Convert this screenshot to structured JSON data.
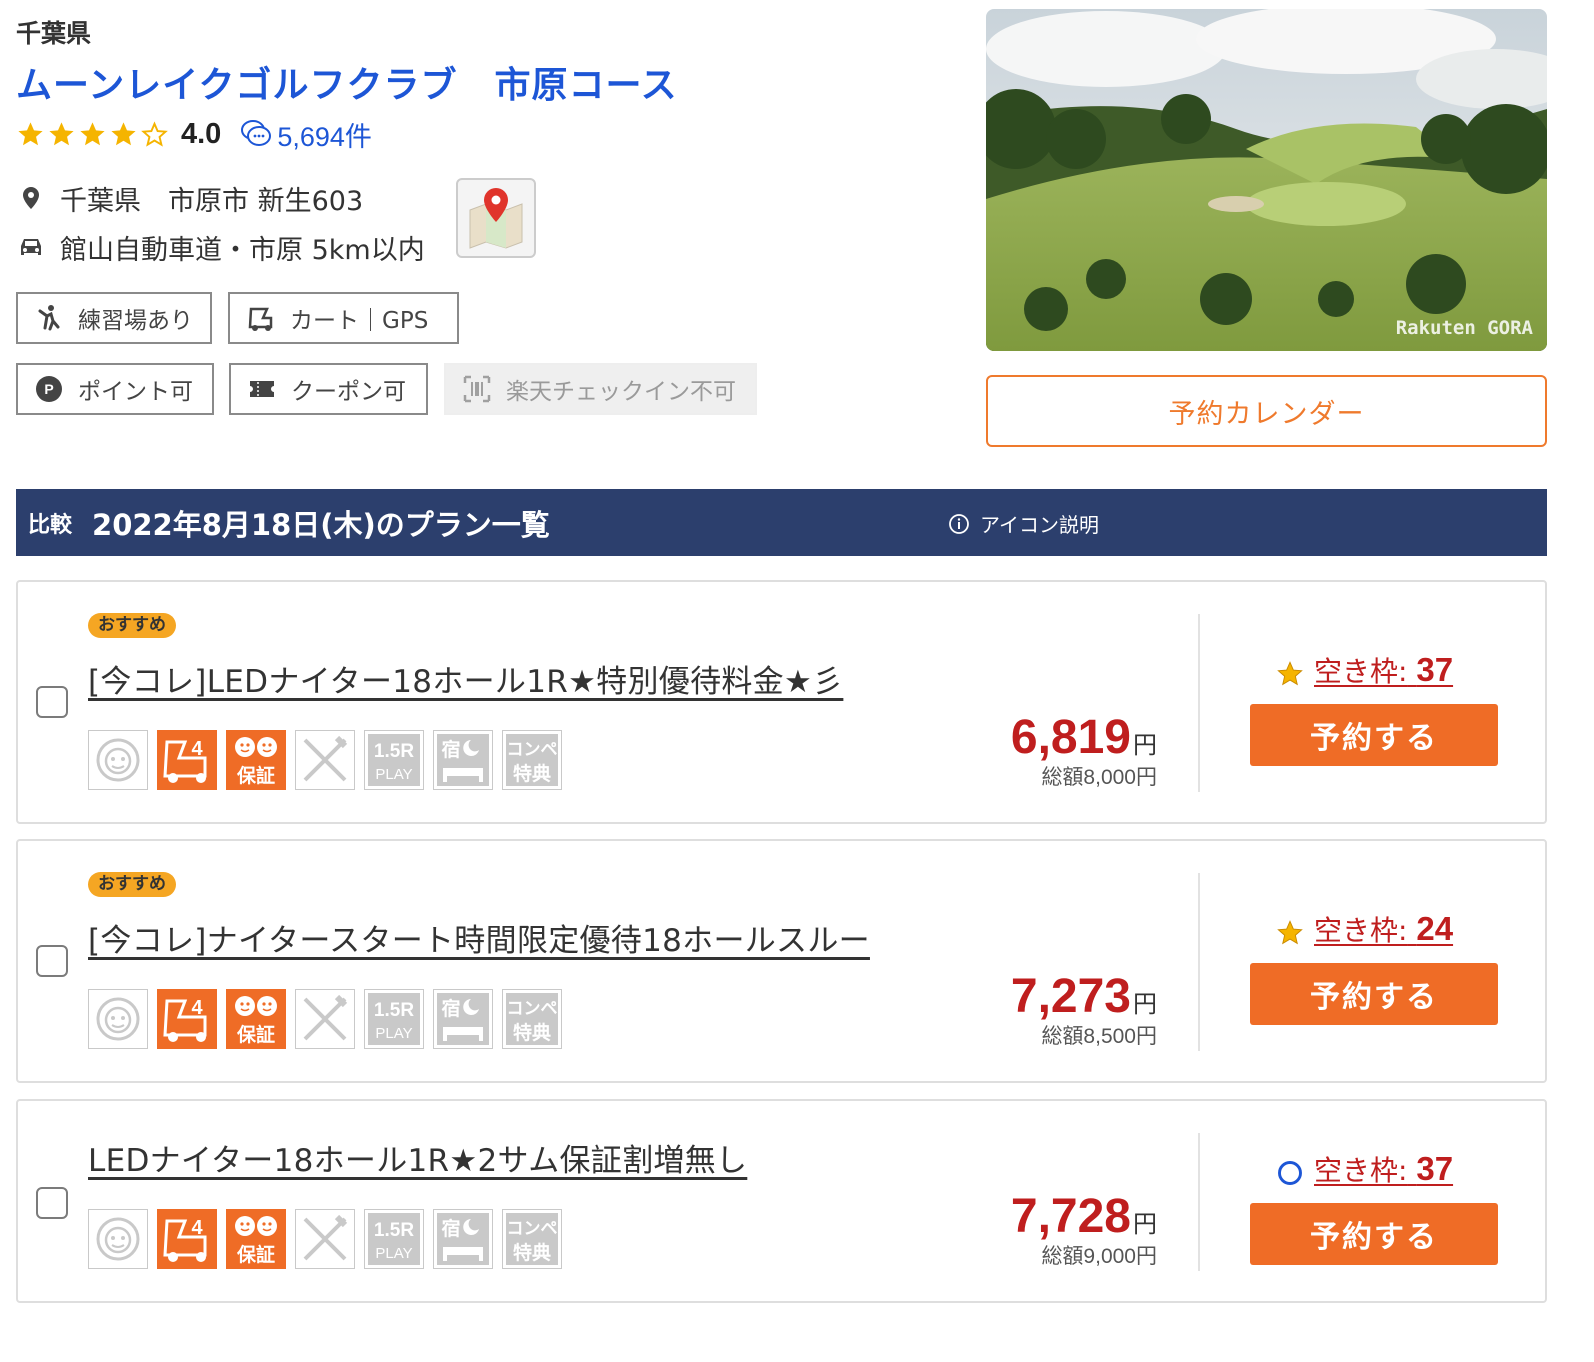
{
  "course": {
    "prefecture": "千葉県",
    "name": "ムーンレイクゴルフクラブ　市原コース",
    "rating": "4.0",
    "rating_stars": 4,
    "review_count": "5,694件",
    "address": "千葉県　市原市 新生603",
    "access": "館山自動車道・市原 5km以内"
  },
  "features": {
    "practice": "練習場あり",
    "cart": "カート｜GPS",
    "point": "ポイント可",
    "coupon": "クーポン可",
    "checkin": "楽天チェックイン不可"
  },
  "photo": {
    "watermark": "Rakuten GORA"
  },
  "calendar_button": "予約カレンダー",
  "plan_header": {
    "compare": "比較",
    "title": "2022年8月18日(木)のプラン一覧",
    "icon_info": "アイコン説明"
  },
  "plan_icons": {
    "caddie": "caddie-icon",
    "cart4": "4-seat-cart-icon",
    "guarantee": "2-player-guarantee-icon",
    "meal": "meal-icon",
    "play15": "1.5R-play-icon",
    "stay": "accommodation-icon",
    "compe": "competition-benefit-icon"
  },
  "plans": [
    {
      "badge": "おすすめ",
      "title": "[今コレ]LEDナイター18ホール1R★特別優待料金★彡",
      "price": "6,819",
      "yen": "円",
      "total": "総額8,000円",
      "avail_label": "空き枠:",
      "avail_count": "37",
      "avail_mark": "star",
      "reserve": "予約する"
    },
    {
      "badge": "おすすめ",
      "title": "[今コレ]ナイタースタート時間限定優待18ホールスルー",
      "price": "7,273",
      "yen": "円",
      "total": "総額8,500円",
      "avail_label": "空き枠:",
      "avail_count": "24",
      "avail_mark": "star",
      "reserve": "予約する"
    },
    {
      "badge": "",
      "title": "LEDナイター18ホール1R★2サム保証割増無し",
      "price": "7,728",
      "yen": "円",
      "total": "総額9,000円",
      "avail_label": "空き枠:",
      "avail_count": "37",
      "avail_mark": "circle",
      "reserve": "予約する"
    }
  ],
  "colors": {
    "link_blue": "#1d56d6",
    "header_navy": "#2c3f6d",
    "accent_orange": "#ef6c26",
    "price_red": "#bf1e1e",
    "star_yellow": "#f5b400"
  }
}
